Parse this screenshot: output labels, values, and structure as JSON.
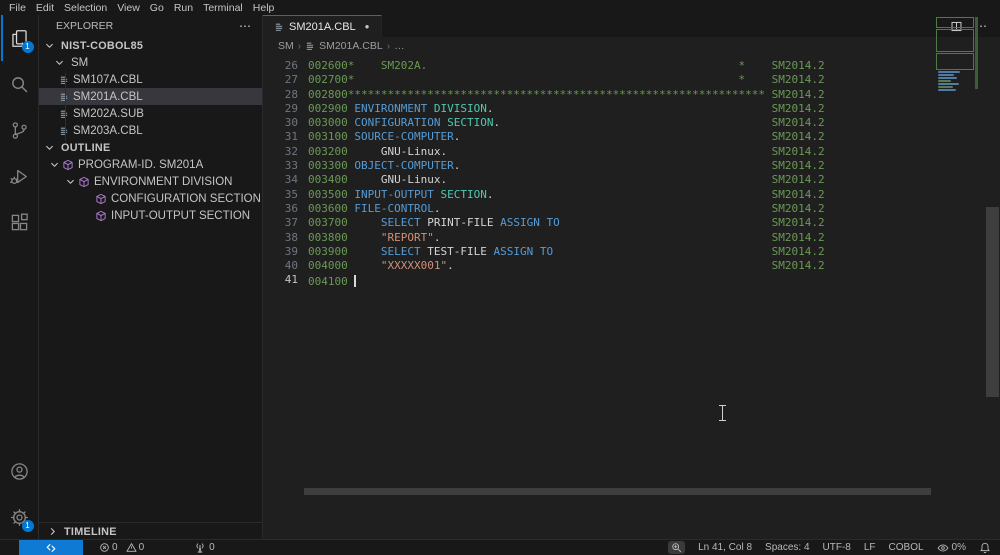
{
  "menu_bar": {
    "items": [
      "File",
      "Edit",
      "Selection",
      "View",
      "Go",
      "Run",
      "Terminal",
      "Help"
    ]
  },
  "activity_bar": {
    "explorer_badge": "1",
    "settings_badge": "1"
  },
  "explorer": {
    "title": "EXPLORER",
    "more_label": "⋯",
    "root_label": "NIST-COBOL85",
    "folder_label": "SM",
    "files": [
      {
        "name": "SM107A.CBL",
        "selected": false
      },
      {
        "name": "SM201A.CBL",
        "selected": true
      },
      {
        "name": "SM202A.SUB",
        "selected": false
      },
      {
        "name": "SM203A.CBL",
        "selected": false
      }
    ],
    "outline": {
      "title": "OUTLINE",
      "items": [
        {
          "label": "PROGRAM-ID. SM201A",
          "level": 1,
          "chevron": true
        },
        {
          "label": "ENVIRONMENT DIVISION",
          "level": 2,
          "chevron": true
        },
        {
          "label": "CONFIGURATION SECTION",
          "level": 3,
          "chevron": false
        },
        {
          "label": "INPUT-OUTPUT SECTION",
          "level": 3,
          "chevron": false
        }
      ]
    },
    "timeline": {
      "title": "TIMELINE"
    }
  },
  "editor": {
    "tab": {
      "title": "SM201A.CBL",
      "modified_dot": "●"
    },
    "breadcrumbs": [
      "SM",
      "SM201A.CBL",
      "…"
    ],
    "lines": [
      {
        "num": "26",
        "segs": [
          {
            "c": "g",
            "t": "002600*    SM202A."
          },
          {
            "sp": 47
          },
          {
            "c": "g",
            "t": "*    SM2014.2"
          }
        ]
      },
      {
        "num": "27",
        "segs": [
          {
            "c": "g",
            "t": "002700*"
          },
          {
            "sp": 58
          },
          {
            "c": "g",
            "t": "*    SM2014.2"
          }
        ]
      },
      {
        "num": "28",
        "segs": [
          {
            "c": "g",
            "t": "002800***************************************************************"
          },
          {
            "c": "g",
            "t": " SM2014.2"
          }
        ]
      },
      {
        "num": "29",
        "segs": [
          {
            "c": "g",
            "t": "002900"
          },
          {
            "sp": 1
          },
          {
            "c": "b",
            "t": "ENVIRONMENT"
          },
          {
            "sp": 1
          },
          {
            "c": "t",
            "t": "DIVISION"
          },
          {
            "c": "w",
            "t": "."
          },
          {
            "sp": 42
          },
          {
            "c": "g",
            "t": "SM2014.2"
          }
        ]
      },
      {
        "num": "30",
        "segs": [
          {
            "c": "g",
            "t": "003000"
          },
          {
            "sp": 1
          },
          {
            "c": "b",
            "t": "CONFIGURATION"
          },
          {
            "sp": 1
          },
          {
            "c": "t",
            "t": "SECTION"
          },
          {
            "c": "w",
            "t": "."
          },
          {
            "sp": 41
          },
          {
            "c": "g",
            "t": "SM2014.2"
          }
        ]
      },
      {
        "num": "31",
        "segs": [
          {
            "c": "g",
            "t": "003100"
          },
          {
            "sp": 1
          },
          {
            "c": "b",
            "t": "SOURCE-COMPUTER"
          },
          {
            "c": "w",
            "t": "."
          },
          {
            "sp": 47
          },
          {
            "c": "g",
            "t": "SM2014.2"
          }
        ]
      },
      {
        "num": "32",
        "segs": [
          {
            "c": "g",
            "t": "003200"
          },
          {
            "sp": 5
          },
          {
            "c": "w",
            "t": "GNU-Linux."
          },
          {
            "sp": 49
          },
          {
            "c": "g",
            "t": "SM2014.2"
          }
        ]
      },
      {
        "num": "33",
        "segs": [
          {
            "c": "g",
            "t": "003300"
          },
          {
            "sp": 1
          },
          {
            "c": "b",
            "t": "OBJECT-COMPUTER"
          },
          {
            "c": "w",
            "t": "."
          },
          {
            "sp": 47
          },
          {
            "c": "g",
            "t": "SM2014.2"
          }
        ]
      },
      {
        "num": "34",
        "segs": [
          {
            "c": "g",
            "t": "003400"
          },
          {
            "sp": 5
          },
          {
            "c": "w",
            "t": "GNU-Linux."
          },
          {
            "sp": 49
          },
          {
            "c": "g",
            "t": "SM2014.2"
          }
        ]
      },
      {
        "num": "35",
        "segs": [
          {
            "c": "g",
            "t": "003500"
          },
          {
            "sp": 1
          },
          {
            "c": "b",
            "t": "INPUT-OUTPUT"
          },
          {
            "sp": 1
          },
          {
            "c": "t",
            "t": "SECTION"
          },
          {
            "c": "w",
            "t": "."
          },
          {
            "sp": 42
          },
          {
            "c": "g",
            "t": "SM2014.2"
          }
        ]
      },
      {
        "num": "36",
        "segs": [
          {
            "c": "g",
            "t": "003600"
          },
          {
            "sp": 1
          },
          {
            "c": "b",
            "t": "FILE-CONTROL"
          },
          {
            "c": "w",
            "t": "."
          },
          {
            "sp": 50
          },
          {
            "c": "g",
            "t": "SM2014.2"
          }
        ]
      },
      {
        "num": "37",
        "segs": [
          {
            "c": "g",
            "t": "003700"
          },
          {
            "sp": 5
          },
          {
            "c": "b",
            "t": "SELECT"
          },
          {
            "sp": 1
          },
          {
            "c": "w",
            "t": "PRINT-FILE"
          },
          {
            "sp": 1
          },
          {
            "c": "b",
            "t": "ASSIGN"
          },
          {
            "sp": 1
          },
          {
            "c": "b",
            "t": "TO"
          },
          {
            "sp": 32
          },
          {
            "c": "g",
            "t": "SM2014.2"
          }
        ]
      },
      {
        "num": "38",
        "segs": [
          {
            "c": "g",
            "t": "003800"
          },
          {
            "sp": 5
          },
          {
            "c": "s",
            "t": "\"REPORT\""
          },
          {
            "c": "w",
            "t": "."
          },
          {
            "sp": 50
          },
          {
            "c": "g",
            "t": "SM2014.2"
          }
        ]
      },
      {
        "num": "39",
        "segs": [
          {
            "c": "g",
            "t": "003900"
          },
          {
            "sp": 5
          },
          {
            "c": "b",
            "t": "SELECT"
          },
          {
            "sp": 1
          },
          {
            "c": "w",
            "t": "TEST-FILE"
          },
          {
            "sp": 1
          },
          {
            "c": "b",
            "t": "ASSIGN"
          },
          {
            "sp": 1
          },
          {
            "c": "b",
            "t": "TO"
          },
          {
            "sp": 33
          },
          {
            "c": "g",
            "t": "SM2014.2"
          }
        ]
      },
      {
        "num": "40",
        "segs": [
          {
            "c": "g",
            "t": "004000"
          },
          {
            "sp": 5
          },
          {
            "c": "s",
            "t": "\"XXXXX001\""
          },
          {
            "c": "w",
            "t": "."
          },
          {
            "sp": 48
          },
          {
            "c": "g",
            "t": "SM2014.2"
          }
        ]
      },
      {
        "num": "41",
        "active": true,
        "segs": [
          {
            "c": "g",
            "t": "004100"
          },
          {
            "sp": 1
          },
          {
            "cursor": true
          }
        ]
      }
    ]
  },
  "status_bar": {
    "remote_icon": "remote-indicator",
    "errors": "0",
    "warnings": "0",
    "ports": "0",
    "cursor_position": "Ln 41, Col 8",
    "indentation": "Spaces: 4",
    "encoding": "UTF-8",
    "eol": "LF",
    "language": "COBOL",
    "screencast_percent": "0%"
  },
  "colors": {
    "accent_blue": "#0078d4",
    "comment_green": "#6a9955",
    "keyword_blue": "#569cd6",
    "type_teal": "#4ec9b0",
    "string_orange": "#ce9178",
    "editor_bg": "#1f1f1f",
    "shell_bg": "#181818",
    "symbol_purple": "#b180d7",
    "selected_row": "#37373d"
  }
}
